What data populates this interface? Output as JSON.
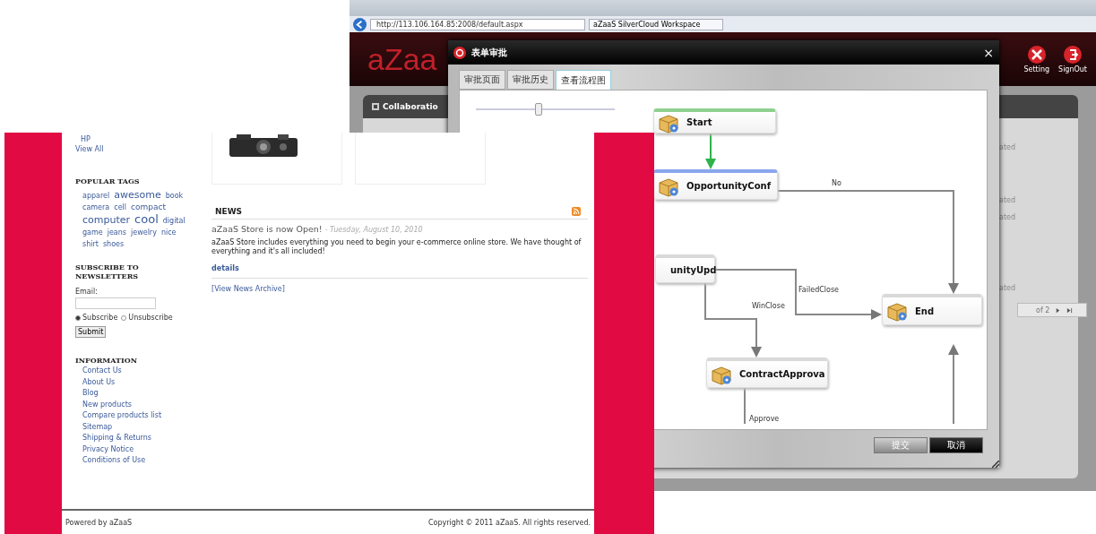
{
  "browser": {
    "address": "http://113.106.164.85:2008/default.aspx",
    "tab": "aZaaS SilverCloud Workspace",
    "logo": "aZaa",
    "header_buttons": [
      {
        "label": "Setting",
        "kind": "setting"
      },
      {
        "label": "SignOut",
        "kind": "signout"
      }
    ],
    "panel_title": "Collaboratio",
    "status_texts": [
      "ated",
      "ated",
      "ated",
      "ated"
    ],
    "pager": "of 2"
  },
  "dialog": {
    "title": "表单审批",
    "close": "×",
    "tabs": [
      {
        "label": "审批页面",
        "selected": false
      },
      {
        "label": "审批历史",
        "selected": false
      },
      {
        "label": "查看流程图",
        "selected": true
      }
    ],
    "zoom_slider": {
      "level": 0.45
    },
    "nodes": [
      {
        "label": "Start",
        "kind": "start"
      },
      {
        "label": "OpportunityConf",
        "kind": "current"
      },
      {
        "label": "unityUpd",
        "kind": "task"
      },
      {
        "label": "ContractApprova",
        "kind": "task"
      },
      {
        "label": "End",
        "kind": "end"
      }
    ],
    "edge_labels": [
      "No",
      "FailedClose",
      "WinClose",
      "Approve"
    ],
    "buttons": [
      {
        "label": "提交",
        "kind": "secondary"
      },
      {
        "label": "取消",
        "kind": "primary"
      }
    ]
  },
  "store": {
    "brands": [
      "HP"
    ],
    "view_all": "View All",
    "tags_title": "POPULAR TAGS",
    "tags": [
      {
        "label": "apparel",
        "kind": "small"
      },
      {
        "label": "awesome",
        "kind": "large"
      },
      {
        "label": "book",
        "kind": "small"
      },
      {
        "label": "camera",
        "kind": "small"
      },
      {
        "label": "cell",
        "kind": "small"
      },
      {
        "label": "compact",
        "kind": "medium"
      },
      {
        "label": "computer",
        "kind": "large"
      },
      {
        "label": "cool",
        "kind": "huge"
      },
      {
        "label": "digital",
        "kind": "small"
      },
      {
        "label": "game",
        "kind": "small"
      },
      {
        "label": "jeans",
        "kind": "small"
      },
      {
        "label": "jewelry",
        "kind": "small"
      },
      {
        "label": "nice",
        "kind": "small"
      },
      {
        "label": "shirt",
        "kind": "small"
      },
      {
        "label": "shoes",
        "kind": "small"
      }
    ],
    "newsletter": {
      "title": "SUBSCRIBE TO NEWSLETTERS",
      "email_label": "Email:",
      "options": [
        {
          "label": "Subscribe",
          "selected": true
        },
        {
          "label": "Unsubscribe",
          "selected": false
        }
      ],
      "submit": "Submit"
    },
    "info_title": "INFORMATION",
    "info_links": [
      "Contact Us",
      "About Us",
      "Blog",
      "New products",
      "Compare products list",
      "Sitemap",
      "Shipping & Returns",
      "Privacy Notice",
      "Conditions of Use"
    ],
    "news": {
      "heading": "NEWS",
      "items": [
        {
          "title": "aZaaS Store is now Open!",
          "date": "- Tuesday, August 10, 2010",
          "body": "aZaaS Store includes everything you need to begin your e-commerce online store. We have thought of everything and it's all included!",
          "link": "details"
        }
      ],
      "archive": "[View News Archive]"
    },
    "footer": {
      "powered": "Powered by aZaaS",
      "copyright": "Copyright © 2011 aZaaS. All rights reserved."
    }
  }
}
